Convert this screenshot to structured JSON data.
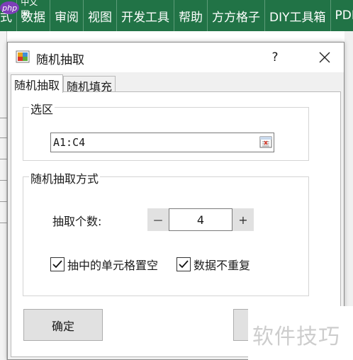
{
  "ribbon": {
    "tabs": [
      "式",
      "数据",
      "审阅",
      "视图",
      "开发工具",
      "帮助",
      "方方格子",
      "DIY工具箱",
      "PDF"
    ]
  },
  "watermark": {
    "top_left": "中文网",
    "top_left_logo": "php",
    "bottom_right": "软件技巧"
  },
  "dialog": {
    "title": "随机抽取",
    "help_label": "?",
    "tabs": [
      {
        "label": "随机抽取",
        "active": true
      },
      {
        "label": "随机填充",
        "active": false
      }
    ],
    "selection_group": {
      "label": "选区",
      "range_value": "A1:C4"
    },
    "method_group": {
      "label": "随机抽取方式",
      "count_label": "抽取个数:",
      "minus_label": "－",
      "count_value": "4",
      "plus_label": "+",
      "clear_checkbox": {
        "label": "抽中的单元格置空",
        "checked": true
      },
      "unique_checkbox": {
        "label": "数据不重复",
        "checked": true
      }
    },
    "ok_button": "确定"
  },
  "colors": {
    "ribbon": "#217346",
    "dialog_bg": "#f0f0f0",
    "button_bg": "#e1e1e1"
  },
  "icons": [
    "app-icon",
    "close-icon",
    "range-select-icon",
    "check-icon"
  ]
}
